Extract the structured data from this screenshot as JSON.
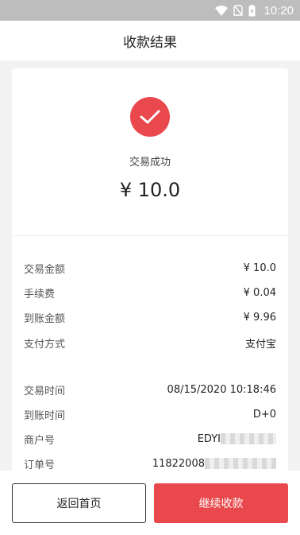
{
  "status_bar": {
    "time": "10:20",
    "icons": [
      "wifi-icon",
      "no-sim-icon",
      "battery-charging-icon"
    ]
  },
  "header": {
    "title": "收款结果"
  },
  "result": {
    "status_text": "交易成功",
    "amount": "¥ 10.0",
    "icon": "check-icon",
    "accent_color": "#e9484d"
  },
  "details": {
    "trade_amount": {
      "label": "交易金额",
      "value": "¥ 10.0"
    },
    "fee": {
      "label": "手续费",
      "value": "¥ 0.04"
    },
    "received_amount": {
      "label": "到账金额",
      "value": "¥ 9.96"
    },
    "pay_method": {
      "label": "支付方式",
      "value": "支付宝"
    },
    "trade_time": {
      "label": "交易时间",
      "value": "08/15/2020 10:18:46"
    },
    "arrival_time": {
      "label": "到账时间",
      "value": "D+0"
    },
    "merchant_no": {
      "label": "商户号",
      "value": "EDYI"
    },
    "order_no": {
      "label": "订单号",
      "value": "11822008"
    }
  },
  "actions": {
    "home_label": "返回首页",
    "continue_label": "继续收款"
  }
}
